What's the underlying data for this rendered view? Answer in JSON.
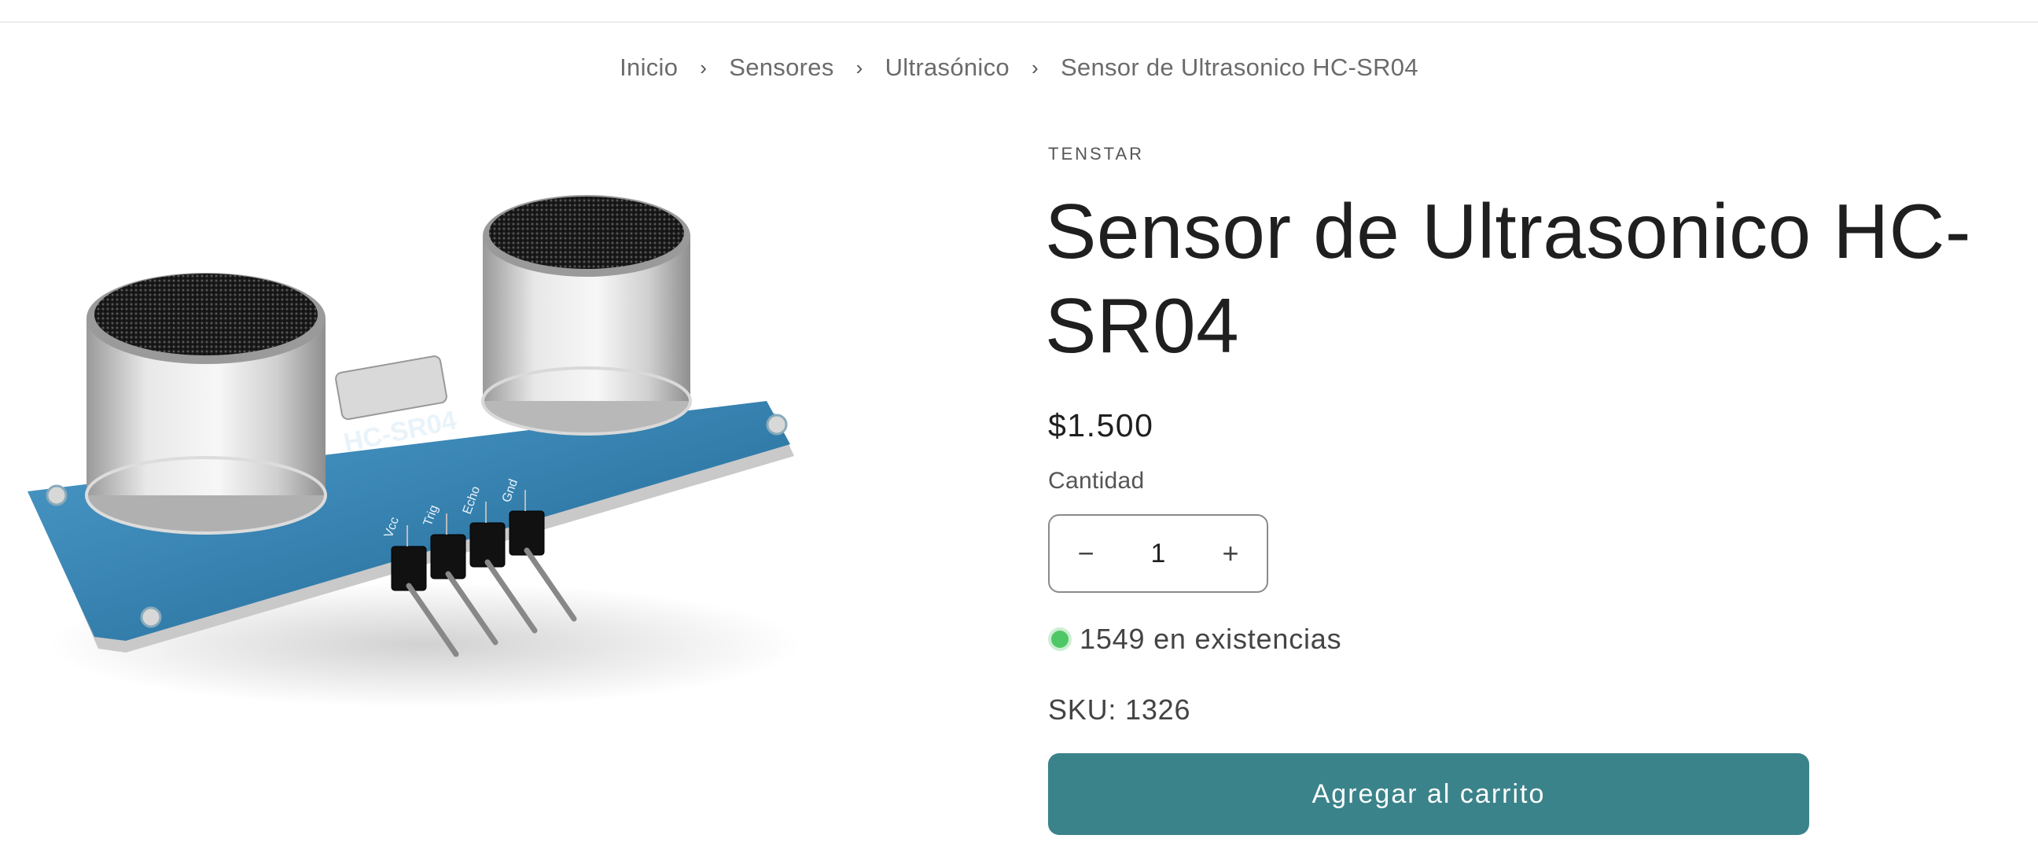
{
  "breadcrumb": {
    "items": [
      "Inicio",
      "Sensores",
      "Ultrasónico"
    ],
    "current": "Sensor de Ultrasonico HC-SR04",
    "separator": "›"
  },
  "product": {
    "vendor": "TENSTAR",
    "title": "Sensor de Ultrasonico HC-SR04",
    "price": "$1.500",
    "quantity_label": "Cantidad",
    "quantity_value": "1",
    "decrease_symbol": "−",
    "increase_symbol": "+",
    "stock_text": "1549 en existencias",
    "sku": "SKU: 1326",
    "add_to_cart": "Agregar al carrito",
    "image": {
      "board_label": "HC-SR04",
      "pin_labels": [
        "Vcc",
        "Trig",
        "Echo",
        "Gnd"
      ]
    }
  },
  "colors": {
    "accent": "#3b838a",
    "stock_dot": "#4fc766",
    "board": "#2f7fae"
  }
}
